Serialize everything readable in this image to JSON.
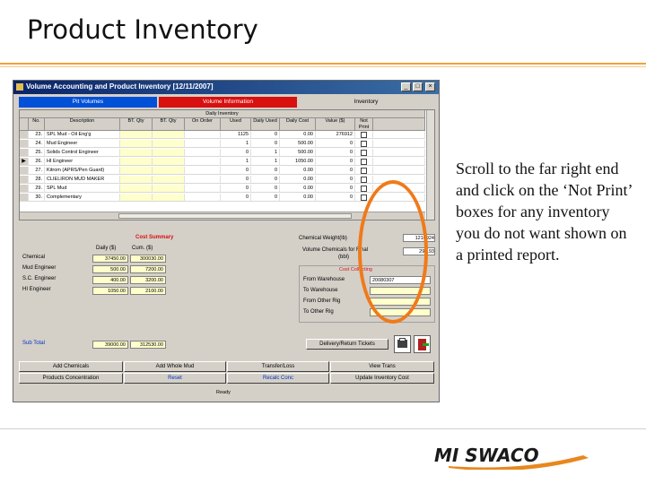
{
  "slide": {
    "title": "Product Inventory",
    "instruction": "Scroll to the far right end and click on the ‘Not Print’ boxes for any inventory you do not want shown on a printed report."
  },
  "window": {
    "title": "Volume Accounting and Product Inventory [12/11/2007]"
  },
  "tabs": [
    {
      "label": "Pit Volumes"
    },
    {
      "label": "Volume Information"
    },
    {
      "label": "Inventory"
    }
  ],
  "grid": {
    "group_header": "Daily Inventory",
    "columns": [
      "No.",
      "Description",
      "BT. Qty",
      "BT. Qty",
      "On Order",
      "Used",
      "Daily Used",
      "Daily Cost",
      "Value ($)",
      "Not Print"
    ],
    "rows": [
      {
        "no": "23.",
        "desc": "SPL Mud - Oil Eng'g",
        "used": "1125",
        "daily": "0",
        "cost": "0.00",
        "value": "276912"
      },
      {
        "no": "24.",
        "desc": "Mud Engineer",
        "used": "1",
        "daily": "0",
        "cost": "500.00",
        "value": "0"
      },
      {
        "no": "25.",
        "desc": "Solids Control Engineer",
        "used": "0",
        "daily": "1",
        "cost": "500.00",
        "value": "0"
      },
      {
        "no": "26.",
        "desc": "HI Engineer",
        "used": "1",
        "daily": "1",
        "cost": "1050.00",
        "value": "0"
      },
      {
        "no": "27.",
        "desc": "Kitrom (APRS/Pen Guard)",
        "used": "0",
        "daily": "0",
        "cost": "0.00",
        "value": "0"
      },
      {
        "no": "28.",
        "desc": "CLIELIRON MUD MAKER",
        "used": "0",
        "daily": "0",
        "cost": "0.00",
        "value": "0"
      },
      {
        "no": "29.",
        "desc": "SPL Mud",
        "used": "0",
        "daily": "0",
        "cost": "0.00",
        "value": "0"
      },
      {
        "no": "30.",
        "desc": "Complementary",
        "used": "0",
        "daily": "0",
        "cost": "0.00",
        "value": "0"
      }
    ]
  },
  "cost_summary": {
    "heading": "Cost Summary",
    "col_daily": "Daily ($)",
    "col_cum": "Cum. ($)",
    "rows": [
      {
        "label": "Chemical",
        "daily": "37450.00",
        "cum": "300030.00"
      },
      {
        "label": "Mud Engineer",
        "daily": "500.00",
        "cum": "7200.00"
      },
      {
        "label": "S.C. Engineer",
        "daily": "400.00",
        "cum": "3200.00"
      },
      {
        "label": "HI Engineer",
        "daily": "1050.00",
        "cum": "2100.00"
      }
    ],
    "subtotal_label": "Sub Total",
    "subtotal_daily": "39000.00",
    "subtotal_cum": "312530.00"
  },
  "right_panel": {
    "chem_weight_label": "Chemical Weight(lb)",
    "chem_weight_value": "1216924",
    "vol_chem_label": "Volume Chemicals for Final",
    "vol_chem_unit": "(bbl)",
    "vol_chem_value": "296.93",
    "transfer_heading": "Cost Collecting",
    "from_warehouse_label": "From Warehouse",
    "from_warehouse_value": "20080307",
    "to_warehouse_label": "To Warehouse",
    "from_other_rig_label": "From Other Rig",
    "to_other_rig_label": "To Other Rig",
    "tickets_button": "Delivery/Return Tickets"
  },
  "buttons": {
    "add_chemicals": "Add Chemicals",
    "add_whole_mud": "Add Whole Mud",
    "transfer_loss": "Transfer/Loss",
    "view_trans": "View Trans",
    "products_conc": "Products Concentration",
    "reset": "Reset",
    "recalc_conc": "Recalc Conc",
    "update_inventory": "Update Inventory Cost"
  },
  "status_bar": "Ready",
  "logo": {
    "text": "MI SWACO"
  },
  "colors": {
    "accent_orange": "#f07a1a",
    "tab_blue": "#0050d8",
    "tab_red": "#d81010"
  }
}
